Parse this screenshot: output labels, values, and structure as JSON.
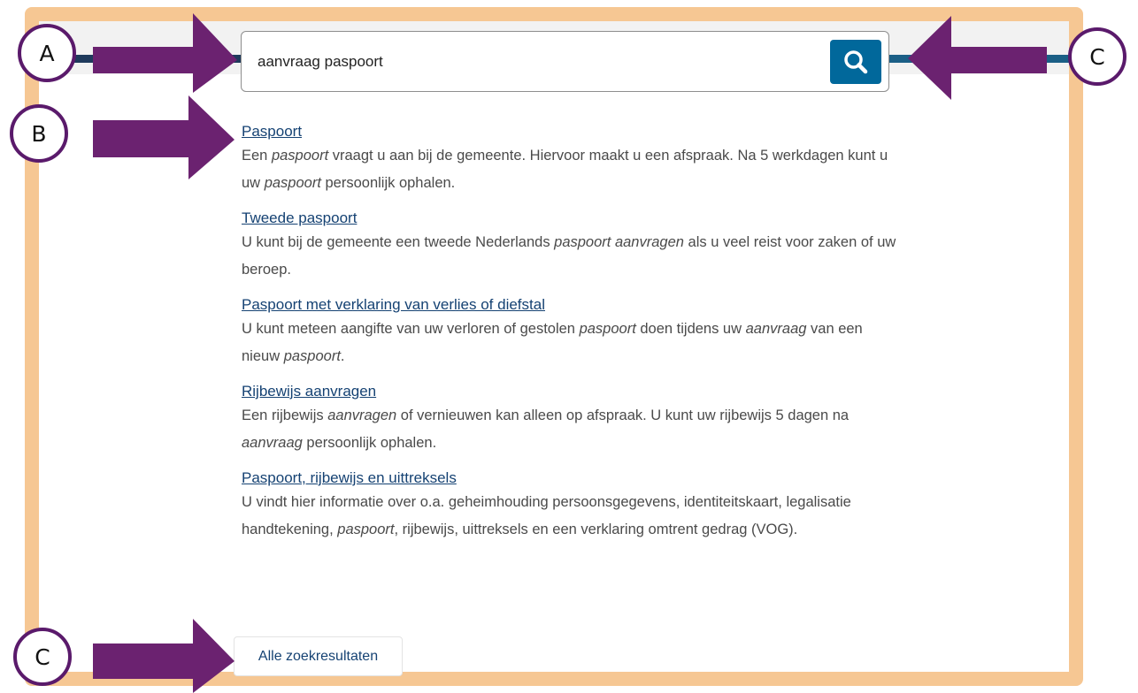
{
  "search": {
    "query": "aanvraag paspoort",
    "button_icon": "search-icon"
  },
  "results": [
    {
      "title": "Paspoort",
      "desc": [
        {
          "t": "Een "
        },
        {
          "t": "paspoort",
          "i": true
        },
        {
          "t": " vraagt u aan bij de gemeente. Hiervoor maakt u een afspraak. Na 5 werkdagen kunt u uw "
        },
        {
          "t": "paspoort",
          "i": true
        },
        {
          "t": " persoonlijk ophalen."
        }
      ]
    },
    {
      "title": "Tweede paspoort",
      "desc": [
        {
          "t": "U kunt bij de gemeente een tweede Nederlands "
        },
        {
          "t": "paspoort aanvragen",
          "i": true
        },
        {
          "t": " als u veel reist voor zaken of uw beroep."
        }
      ]
    },
    {
      "title": "Paspoort met verklaring van verlies of diefstal",
      "desc": [
        {
          "t": "U kunt meteen aangifte van uw verloren of gestolen "
        },
        {
          "t": "paspoort",
          "i": true
        },
        {
          "t": " doen tijdens uw "
        },
        {
          "t": "aanvraag",
          "i": true
        },
        {
          "t": " van een nieuw "
        },
        {
          "t": "paspoort",
          "i": true
        },
        {
          "t": "."
        }
      ]
    },
    {
      "title": "Rijbewijs aanvragen",
      "desc": [
        {
          "t": "Een rijbewijs "
        },
        {
          "t": "aanvragen",
          "i": true
        },
        {
          "t": " of vernieuwen kan alleen op afspraak. U kunt uw rijbewijs 5 dagen na "
        },
        {
          "t": "aanvraag",
          "i": true
        },
        {
          "t": " persoonlijk ophalen."
        }
      ]
    },
    {
      "title": "Paspoort, rijbewijs en uittreksels",
      "desc": [
        {
          "t": "U vindt hier informatie over o.a. geheimhouding persoonsgegevens, identiteitskaart, legalisatie handtekening, "
        },
        {
          "t": "paspoort",
          "i": true
        },
        {
          "t": ", rijbewijs, uittreksels en een verklaring omtrent gedrag (VOG)."
        }
      ]
    }
  ],
  "all_results_label": "Alle zoekresultaten",
  "annotations": {
    "a": "A",
    "b": "B",
    "c_top": "C",
    "c_bottom": "C",
    "arrow_color": "#6b2270"
  },
  "colors": {
    "frame": "#f6c793",
    "link": "#154273",
    "search_button": "#01689b",
    "circle_border": "#5a1a6b"
  }
}
